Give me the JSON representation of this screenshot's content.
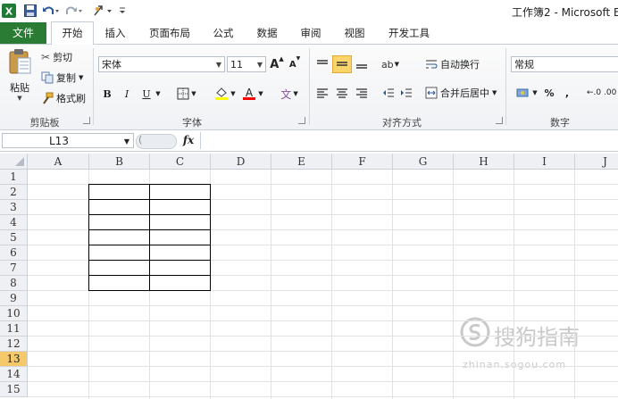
{
  "titlebar": {
    "title": "工作簿2 - Microsoft E",
    "quick_access": [
      "excel-logo-icon",
      "save-icon",
      "undo-icon",
      "redo-icon",
      "customize-icon"
    ]
  },
  "tabs": {
    "file": "文件",
    "items": [
      {
        "label": "开始",
        "active": true
      },
      {
        "label": "插入"
      },
      {
        "label": "页面布局"
      },
      {
        "label": "公式"
      },
      {
        "label": "数据"
      },
      {
        "label": "审阅"
      },
      {
        "label": "视图"
      },
      {
        "label": "开发工具"
      }
    ]
  },
  "ribbon": {
    "clipboard": {
      "paste": "粘贴",
      "cut": "剪切",
      "copy": "复制",
      "format_painter": "格式刷",
      "label": "剪贴板"
    },
    "font": {
      "font_name": "宋体",
      "font_size": "11",
      "bold": "B",
      "italic": "I",
      "underline": "U",
      "grow": "A",
      "shrink": "A",
      "phonetic": "wén",
      "label": "字体",
      "fill_color": "#ffff00",
      "font_color": "#ff0000"
    },
    "alignment": {
      "wrap_text": "自动换行",
      "merge_center": "合并后居中",
      "label": "对齐方式"
    },
    "number": {
      "format": "常规",
      "percent": "%",
      "comma": ",",
      "inc_decimal": "←.0 .00",
      "label": "数字"
    }
  },
  "formula_bar": {
    "name_box": "L13",
    "fx": "fx"
  },
  "sheet": {
    "columns": [
      "A",
      "B",
      "C",
      "D",
      "E",
      "F",
      "G",
      "H",
      "I",
      "J"
    ],
    "rows": [
      "1",
      "2",
      "3",
      "4",
      "5",
      "6",
      "7",
      "8",
      "9",
      "10",
      "11",
      "12",
      "13",
      "14",
      "15"
    ],
    "selected_row": "13",
    "selected_cell": "L13"
  },
  "watermark": {
    "main": "搜狗指南",
    "sub": "zhinan.sogou.com"
  }
}
